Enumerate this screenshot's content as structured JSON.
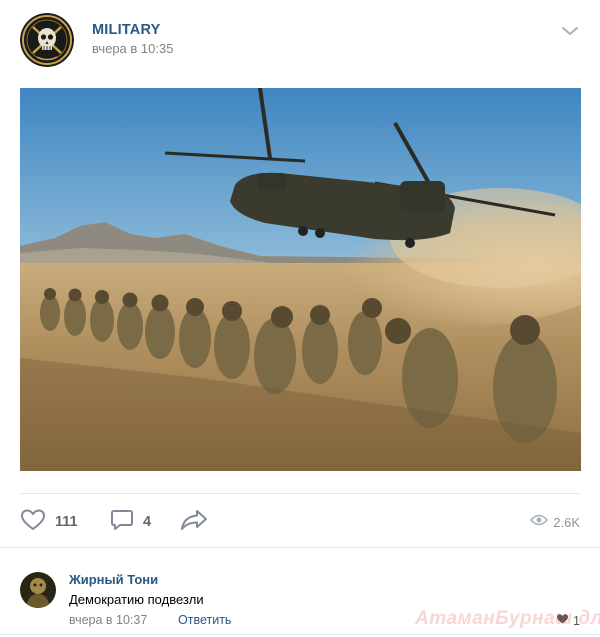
{
  "post": {
    "group_name": "MILITARY",
    "time": "вчера в 10:35",
    "avatar_icon": "skull-emblem-icon",
    "menu_icon": "chevron-down-icon"
  },
  "photo": {
    "subject": "military-helicopter-landing-soldiers"
  },
  "actions": {
    "likes": "111",
    "comments": "4",
    "views": "2.6K"
  },
  "comment": {
    "author": "Жирный Тони",
    "text": "Демократию подвезли",
    "time": "вчера в 10:37",
    "reply_label": "Ответить",
    "likes": "1"
  },
  "watermark": "АтаманБурнаш для ЯП",
  "colors": {
    "link": "#2a5885",
    "meta": "#828282",
    "icon": "#828a99",
    "divider": "#e7e8ec"
  }
}
